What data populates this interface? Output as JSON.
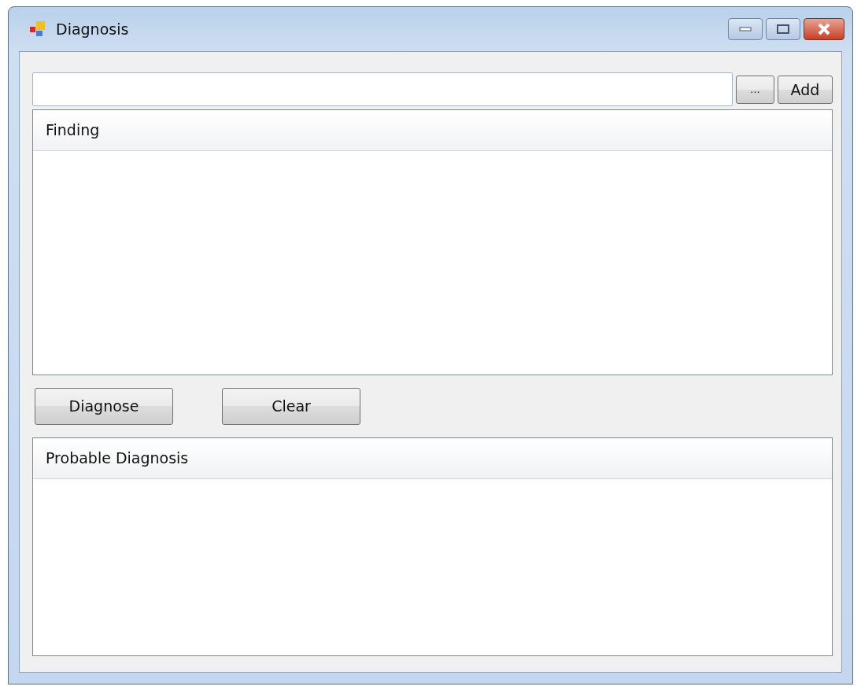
{
  "window": {
    "title": "Diagnosis"
  },
  "finding_input": {
    "side_buttons": [
      "...",
      "Add"
    ]
  },
  "findings_list": {
    "columns": [
      "Finding"
    ]
  },
  "actions": [
    "Diagnose",
    "Clear"
  ],
  "diagnosis_list": {
    "columns": [
      "Probable Diagnosis"
    ]
  }
}
